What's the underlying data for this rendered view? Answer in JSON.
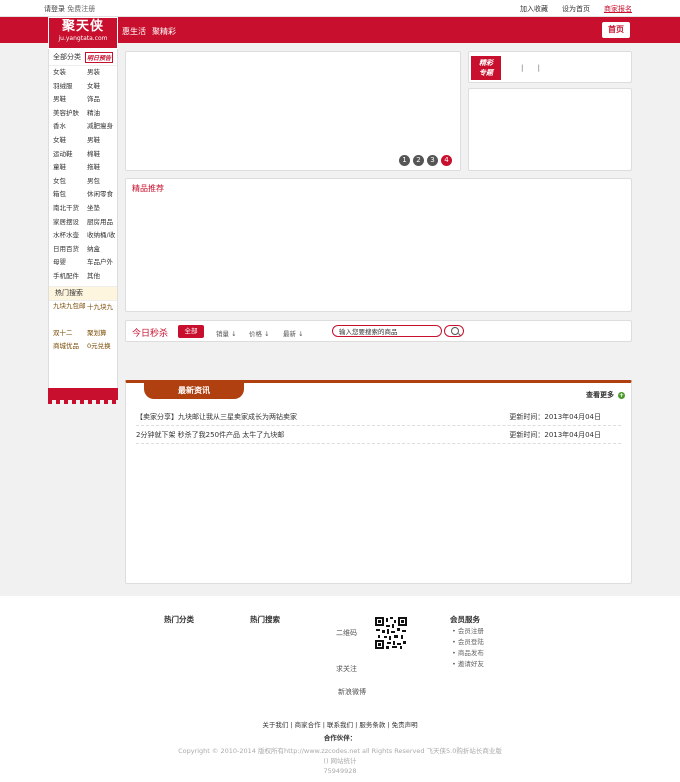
{
  "topbar": {
    "login": "请登录",
    "register": "免费注册",
    "favorite": "加入收藏",
    "set_home": "设为首页",
    "merchant_signup": "商家报名"
  },
  "logo": {
    "name": "聚天侠",
    "domain": "ju.yangtata.com"
  },
  "nav": {
    "items": [
      "惠生活",
      "聚精彩"
    ],
    "home": "首页"
  },
  "sidebar": {
    "all_categories": "全部分类",
    "preview_badge": "明日预告",
    "categories": [
      "女装",
      "男装",
      "羽绒服",
      "女鞋",
      "男鞋",
      "饰品",
      "美容护肤",
      "精油",
      "香水",
      "减肥瘦身",
      "女鞋",
      "男鞋",
      "运动鞋",
      "棉鞋",
      "童鞋",
      "拖鞋",
      "女包",
      "男包",
      "箱包",
      "休闲零食",
      "南北干货",
      "坐垫",
      "家居摆设",
      "厨房用品",
      "水杯水壶",
      "收纳桶/收纳盒",
      "日用百货",
      "母婴",
      "车品户外",
      "手机配件",
      "其他"
    ],
    "hot_search": "热门搜索",
    "hot_items": [
      "九块九包邮",
      "十九块九",
      "双十二",
      "聚划算",
      "商城优品",
      "0元兑换"
    ]
  },
  "banner": {
    "pages": [
      "1",
      "2",
      "3",
      "4"
    ],
    "active": 4
  },
  "special": {
    "tag_line1": "精彩",
    "tag_line2": "专题",
    "separators": "| |"
  },
  "recommend": {
    "title": "精品推荐"
  },
  "seckill": {
    "title": "今日秒杀",
    "all": "全部",
    "sort_sales": "销量",
    "sort_price": "价格",
    "sort_newest": "最新",
    "search_placeholder": "输入您要搜索的商品"
  },
  "news": {
    "tab": "最新资讯",
    "more": "查看更多",
    "items": [
      {
        "title": "【卖家分享】九块邮让我从三星卖家成长为两钻卖家",
        "date": "更新时间：2013年04月04日"
      },
      {
        "title": "2分钟就下架 秒杀了我250件产品 太牛了九块邮",
        "date": "更新时间：2013年04月04日"
      }
    ]
  },
  "footer": {
    "hot_categories": "热门分类",
    "hot_search": "热门搜索",
    "qrcode": "二维码",
    "follow": "求关注",
    "weibo": "新浪微博",
    "member_service": "会员服务",
    "member_links": [
      "会员注册",
      "会员登陆",
      "商品发布",
      "邀请好友"
    ],
    "links": [
      "关于我们",
      "商家合作",
      "联系我们",
      "服务条款",
      "免责声明"
    ],
    "partners": "合作伙伴：",
    "copyright": "Copyright © 2010-2014 版权所有http://www.zzcodes.net all Rights Reserved 飞天侠5.0购折站长商业版",
    "stats": "() 网站统计",
    "counter": "75949928"
  }
}
